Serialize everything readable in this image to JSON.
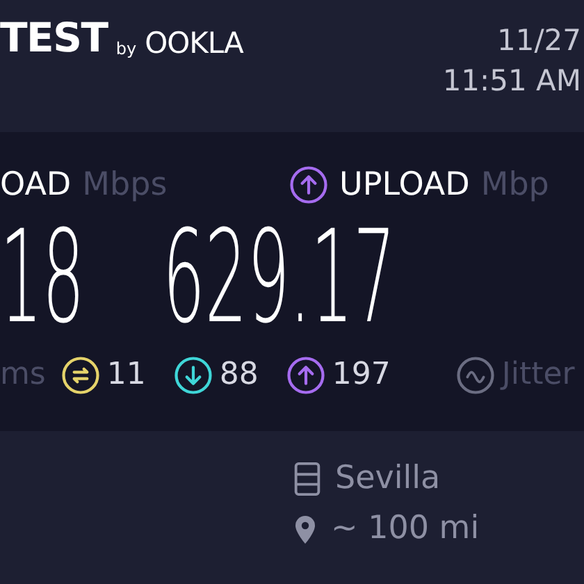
{
  "header": {
    "logo": {
      "word": "TEST",
      "by": "by",
      "brand": "OOKLA"
    },
    "date": "11/27",
    "time": "11:51 AM"
  },
  "download": {
    "label": "OAD",
    "unit": "Mbps",
    "value": "18"
  },
  "upload": {
    "label": "UPLOAD",
    "unit": "Mbp",
    "value": "629.17"
  },
  "stats": [
    {
      "kind": "unit",
      "text": "ms"
    },
    {
      "kind": "ping",
      "text": "11",
      "color": "#e5d36a"
    },
    {
      "kind": "down",
      "text": "88",
      "color": "#3fd6d8"
    },
    {
      "kind": "up",
      "text": "197",
      "color": "#a66cf0"
    },
    {
      "kind": "jitter",
      "text": "Jitter",
      "color": "#6b6d82"
    }
  ],
  "server": {
    "name": "Sevilla",
    "distance": "~ 100 mi"
  }
}
